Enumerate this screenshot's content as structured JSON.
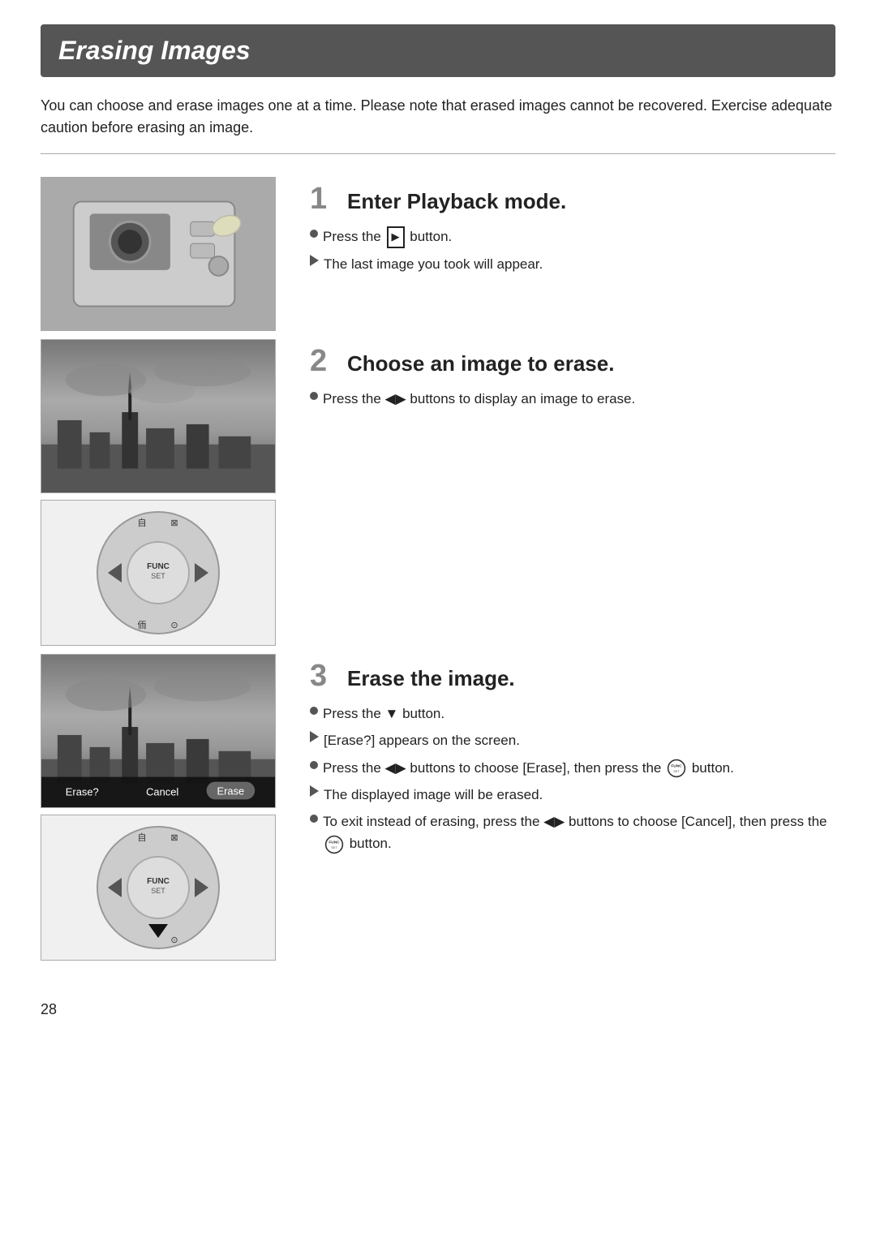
{
  "page": {
    "title": "Erasing Images",
    "intro": "You can choose and erase images one at a time. Please note that erased images cannot be recovered. Exercise adequate caution before erasing an image.",
    "page_number": "28"
  },
  "steps": [
    {
      "number": "1",
      "title": "Enter Playback mode.",
      "bullets": [
        {
          "type": "circle",
          "text": "Press the ▶ button."
        },
        {
          "type": "triangle",
          "text": "The last image you took will appear."
        }
      ]
    },
    {
      "number": "2",
      "title": "Choose an image to erase.",
      "bullets": [
        {
          "type": "circle",
          "text": "Press the ◀▶ buttons to display an image to erase."
        }
      ]
    },
    {
      "number": "3",
      "title": "Erase the image.",
      "bullets": [
        {
          "type": "circle",
          "text": "Press the ▼ button."
        },
        {
          "type": "triangle",
          "text": "[Erase?] appears on the screen."
        },
        {
          "type": "circle",
          "text": "Press the ◀▶ buttons to choose [Erase], then press the  button."
        },
        {
          "type": "triangle",
          "text": "The displayed image will be erased."
        },
        {
          "type": "circle",
          "text": "To exit instead of erasing, press the ◀▶ buttons to choose [Cancel], then press the  button."
        }
      ]
    }
  ],
  "erase_dialog": {
    "label": "Erase?",
    "cancel": "Cancel",
    "erase": "Erase"
  }
}
